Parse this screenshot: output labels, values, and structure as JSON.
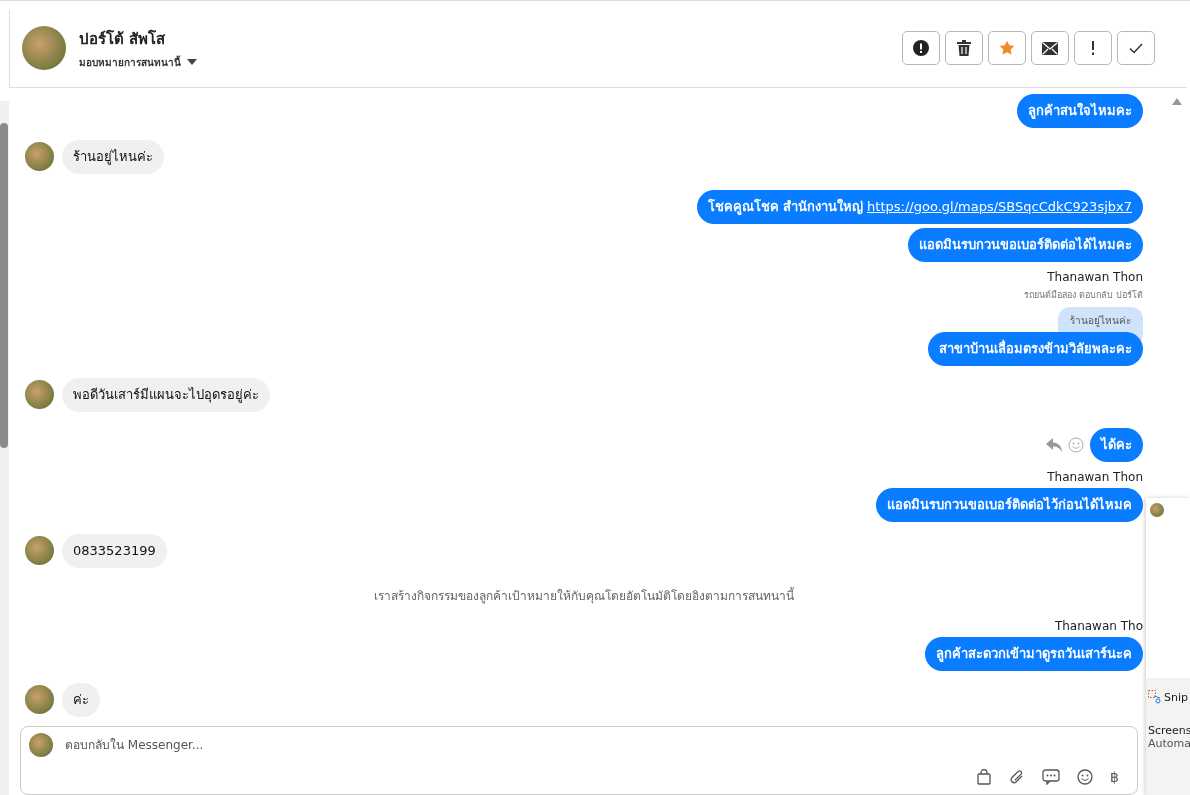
{
  "header": {
    "name": "ปอร์โต้ สัพโส",
    "assign": "มอบหมายการสนทนานี้"
  },
  "actions": [
    {
      "kind": "alert"
    },
    {
      "kind": "trash"
    },
    {
      "kind": "star"
    },
    {
      "kind": "mail"
    },
    {
      "kind": "exclaim"
    },
    {
      "kind": "check"
    }
  ],
  "messages": [
    {
      "kind": "outgoing",
      "text": "ลูกค้าสนใจไหมคะ"
    },
    {
      "kind": "incoming",
      "text": "ร้านอยู่ไหนค่ะ"
    },
    {
      "kind": "outgoing",
      "text": "โชคคูณโชค สำนักงานใหญ่",
      "link": "https://goo.gl/maps/SBSqcCdkC923sjbx7"
    },
    {
      "kind": "outgoing",
      "text": "แอดมินรบกวนขอเบอร์ติดต่อได้ไหมคะ"
    },
    {
      "kind": "sender",
      "text": "Thanawan Thon"
    },
    {
      "kind": "reply",
      "note": "รถยนต์มือสอง ตอบกลับ ปอร์โต้",
      "quote": "ร้านอยู่ไหนค่ะ",
      "text": "สาขาบ้านเลื่อมตรงข้ามวิลัยพละคะ"
    },
    {
      "kind": "incoming",
      "text": "พอดีวันเสาร์มีแผนจะไปอุดรอยู่ค่ะ"
    },
    {
      "kind": "outgoing",
      "text": "ได้คะ",
      "hovered": true
    },
    {
      "kind": "sender",
      "text": "Thanawan Thon"
    },
    {
      "kind": "outgoing",
      "text": "แอดมินรบกวนขอเบอร์ติดต่อไว้ก่อนได้ไหมค"
    },
    {
      "kind": "incoming",
      "text": "0833523199"
    },
    {
      "kind": "system",
      "text": "เราสร้างกิจกรรมของลูกค้าเป้าหมายให้กับคุณโดยอัตโนมัติโดยอิงตามการสนทนานี้"
    },
    {
      "kind": "sender",
      "text": "Thanawan Tho"
    },
    {
      "kind": "outgoing",
      "text": "ลูกค้าสะดวกเข้ามาดูรถวันเสาร์นะค"
    },
    {
      "kind": "incoming",
      "text": "ค่ะ"
    }
  ],
  "composer": {
    "placeholder": "ตอบกลับใน Messenger...",
    "currency": "฿"
  },
  "notification": {
    "app": "Snip",
    "title": "Screens",
    "body": "Automa"
  }
}
